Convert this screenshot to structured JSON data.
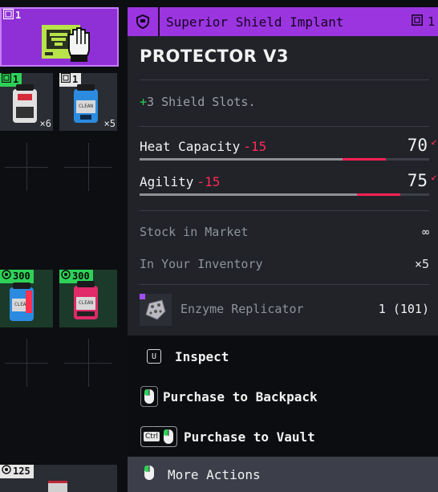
{
  "inventory": {
    "slots": [
      {
        "badge": "1",
        "badge_style": "plain",
        "selected": true
      },
      {
        "badge": "1",
        "badge_style": "green",
        "qty": "×6",
        "canister_color": "#e0e0e0",
        "canister_accent": "#d62c3a"
      },
      {
        "badge": "1",
        "badge_style": "white",
        "qty": "×5",
        "canister_color": "#2b8be0",
        "canister_accent": "#7ee0ff"
      },
      {
        "badge": "300",
        "badge_style": "green",
        "canister_color": "#2b8be0",
        "canister_accent": "#ff3050"
      },
      {
        "badge": "300",
        "badge_style": "green",
        "canister_color": "#2b8be0",
        "canister_accent": "#ff3080"
      },
      {
        "badge": "125",
        "badge_style": "white"
      }
    ]
  },
  "header": {
    "title": "Superior Shield Implant",
    "count": "1",
    "accent": "#9b35e0"
  },
  "item": {
    "name": "PROTECTOR V3",
    "effect_sign": "+",
    "effect_text": "3 Shield Slots."
  },
  "stats": [
    {
      "label": "Heat Capacity",
      "delta": "-15",
      "value": "70",
      "base_fraction": 0.7,
      "reduced_fraction": 0.85
    },
    {
      "label": "Agility",
      "delta": "-15",
      "value": "75",
      "base_fraction": 0.75,
      "reduced_fraction": 0.9
    }
  ],
  "info": {
    "stock_label": "Stock in Market",
    "stock_value": "∞",
    "inventory_label": "In Your Inventory",
    "inventory_value": "×5"
  },
  "cost": {
    "name": "Enzyme Replicator",
    "amount": "1 (101)"
  },
  "actions": {
    "inspect": {
      "key": "U",
      "label": "Inspect"
    },
    "backpack": {
      "label": "Purchase to Backpack"
    },
    "vault": {
      "key": "Ctrl",
      "label": "Purchase to Vault"
    },
    "more": {
      "label": "More Actions"
    }
  },
  "colors": {
    "negative": "#ff2a55",
    "positive": "#2ed158",
    "badge": "#2ed158"
  }
}
